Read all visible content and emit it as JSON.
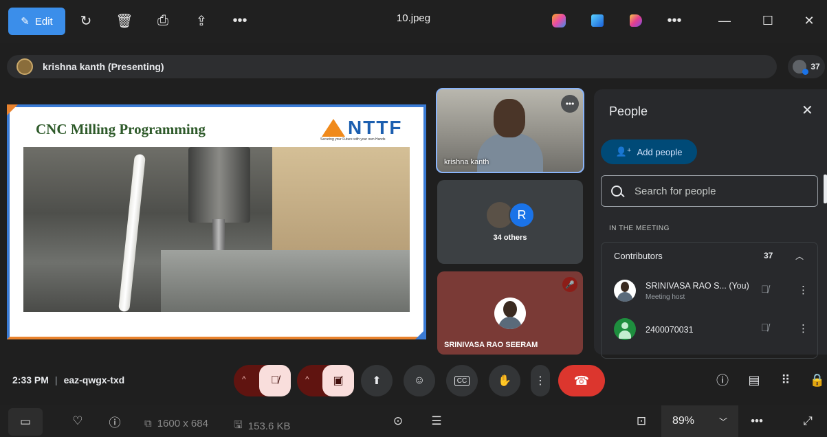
{
  "viewer": {
    "edit_label": "Edit",
    "filename": "10.jpeg",
    "resolution": "1600 x 684",
    "filesize": "153.6 KB",
    "zoom": "89%"
  },
  "meet": {
    "presenter": "krishna kanth (Presenting)",
    "participant_count": "37",
    "time": "2:33 PM",
    "meeting_code": "eaz-qwgx-txd"
  },
  "slide": {
    "title": "CNC Milling Programming",
    "logo_text": "NTTF",
    "logo_tagline": "Securing your Future with your own Hands"
  },
  "tiles": {
    "camera_name": "krishna kanth",
    "others_label": "34 others",
    "others_initial": "R",
    "host_name": "SRINIVASA RAO SEERAM"
  },
  "people_panel": {
    "title": "People",
    "add_people": "Add people",
    "search_placeholder": "Search for people",
    "section": "IN THE MEETING",
    "group_label": "Contributors",
    "group_count": "37",
    "people": [
      {
        "name": "SRINIVASA RAO S...  (You)",
        "role": "Meeting host"
      },
      {
        "name": "2400070031",
        "role": ""
      }
    ]
  },
  "colors": {
    "accent": "#3b8eea",
    "hangup": "#dc362e",
    "muted_group": "#601410"
  }
}
